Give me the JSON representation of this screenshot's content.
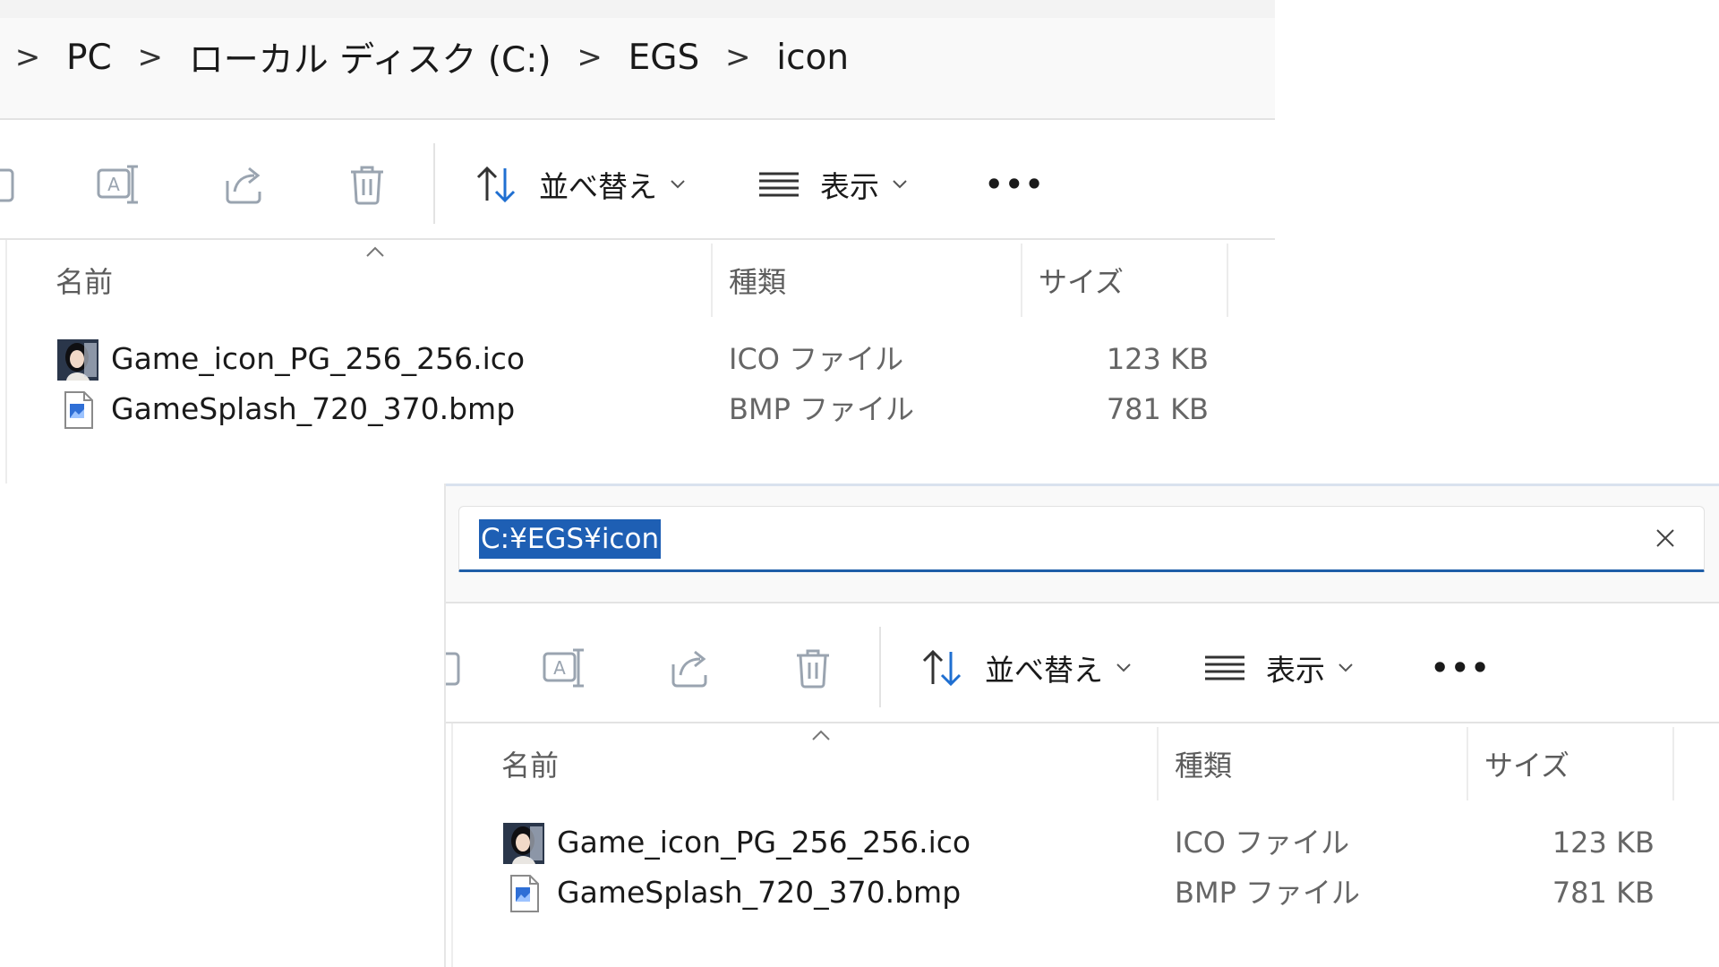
{
  "top_window": {
    "breadcrumb": {
      "separator": ">",
      "items": [
        "PC",
        "ローカル ディスク (C:)",
        "EGS",
        "icon"
      ]
    },
    "toolbar": {
      "sort_label": "並べ替え",
      "view_label": "表示",
      "more_label": "•••"
    },
    "columns": {
      "name": "名前",
      "type": "種類",
      "size": "サイズ"
    },
    "files": [
      {
        "name": "Game_icon_PG_256_256.ico",
        "type": "ICO ファイル",
        "size": "123 KB",
        "icon": "ico-portrait-icon"
      },
      {
        "name": "GameSplash_720_370.bmp",
        "type": "BMP ファイル",
        "size": "781 KB",
        "icon": "bmp-file-icon"
      }
    ]
  },
  "bottom_window": {
    "address_input": {
      "value": "C:¥EGS¥icon"
    },
    "toolbar": {
      "sort_label": "並べ替え",
      "view_label": "表示",
      "more_label": "•••"
    },
    "columns": {
      "name": "名前",
      "type": "種類",
      "size": "サイズ"
    },
    "files": [
      {
        "name": "Game_icon_PG_256_256.ico",
        "type": "ICO ファイル",
        "size": "123 KB",
        "icon": "ico-portrait-icon"
      },
      {
        "name": "GameSplash_720_370.bmp",
        "type": "BMP ファイル",
        "size": "781 KB",
        "icon": "bmp-file-icon"
      }
    ]
  },
  "colors": {
    "selection": "#1e5fb4",
    "focus_underline": "#1f5ea8",
    "sort_arrow_blue": "#1f6fd1"
  }
}
